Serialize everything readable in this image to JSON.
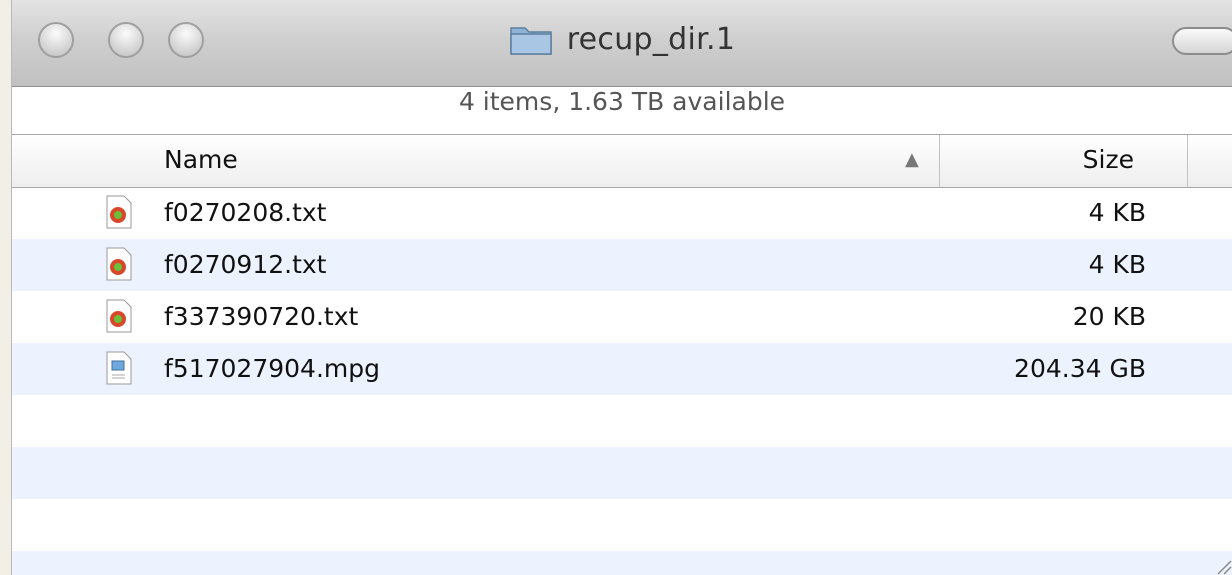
{
  "window": {
    "title": "recup_dir.1",
    "title_icon": "folder-icon"
  },
  "status": {
    "text": "4 items, 1.63 TB available"
  },
  "columns": {
    "name": "Name",
    "size": "Size",
    "sort": "ascending"
  },
  "files": [
    {
      "name": "f0270208.txt",
      "size": "4 KB",
      "icon": "text-document-icon"
    },
    {
      "name": "f0270912.txt",
      "size": "4 KB",
      "icon": "text-document-icon"
    },
    {
      "name": "f337390720.txt",
      "size": "20 KB",
      "icon": "text-document-icon"
    },
    {
      "name": "f517027904.mpg",
      "size": "204.34 GB",
      "icon": "movie-document-icon"
    }
  ],
  "colors": {
    "alt_row": "#edf3fe",
    "text_icon_badge": "#d9472b"
  }
}
